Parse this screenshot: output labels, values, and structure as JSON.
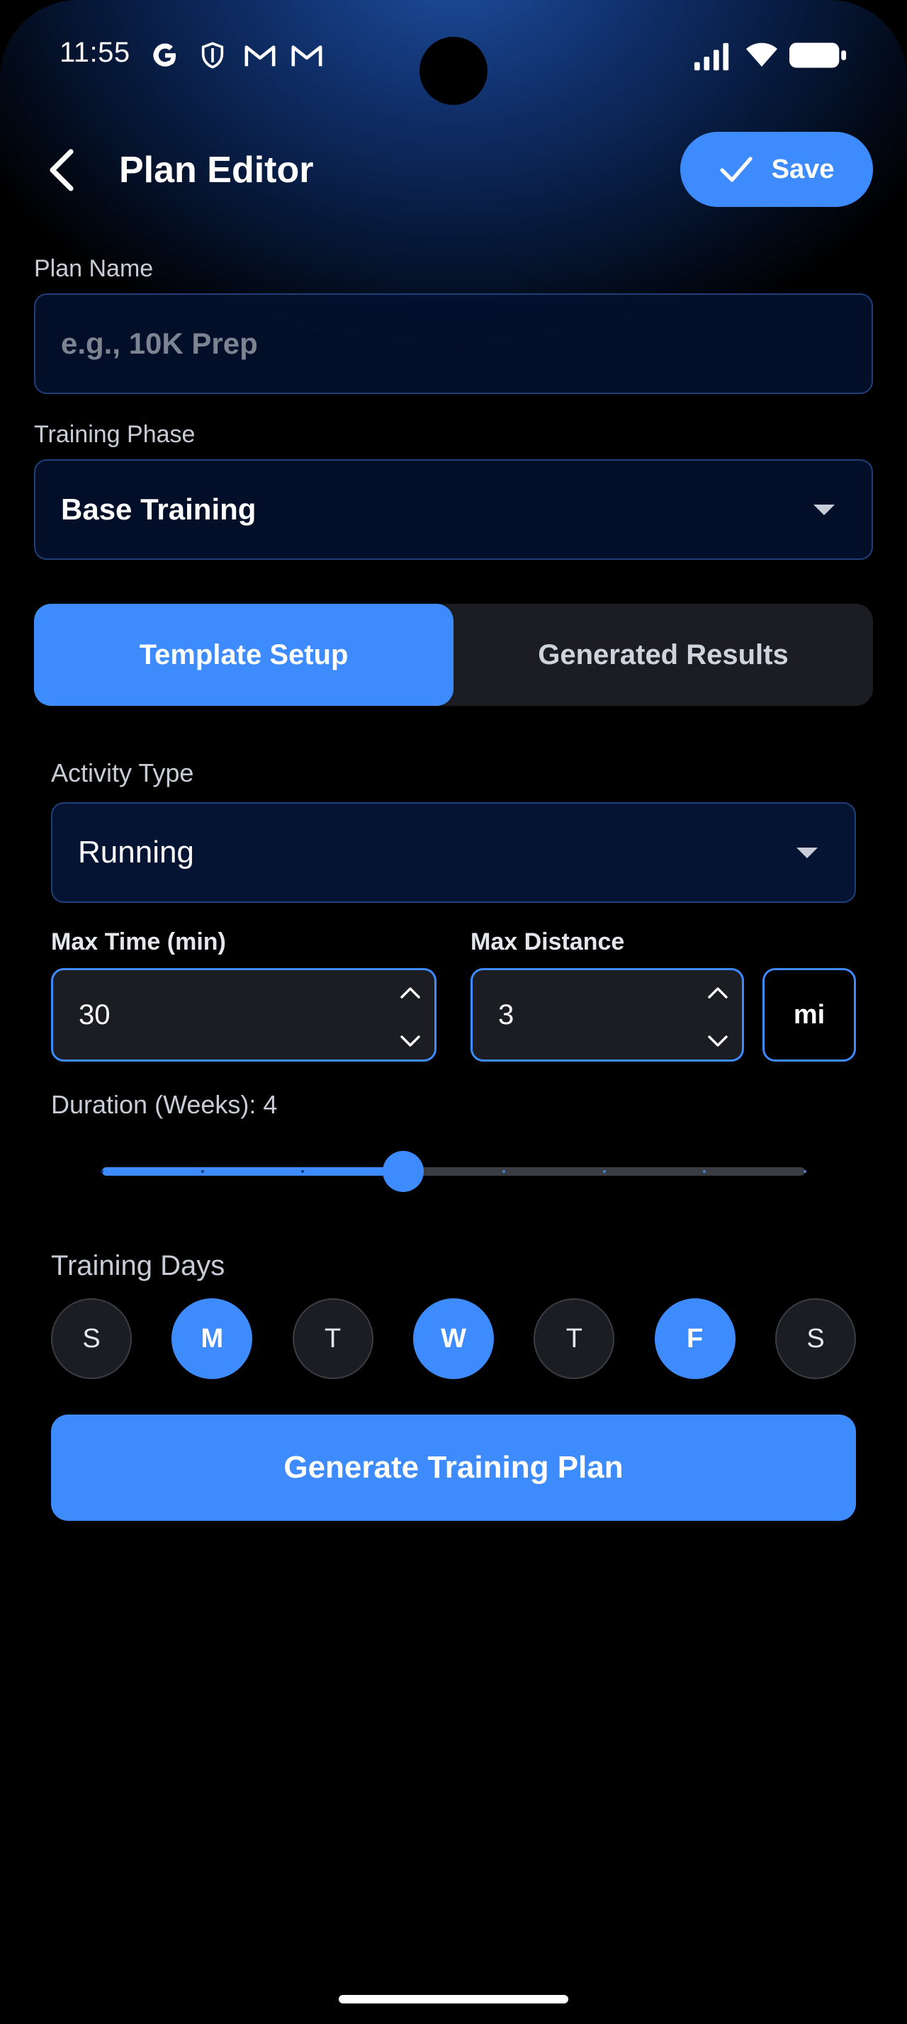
{
  "status_bar": {
    "time": "11:55",
    "icons": [
      "google-g-icon",
      "shield-icon",
      "gmail-icon",
      "gmail-icon",
      "signal-icon",
      "wifi-icon",
      "battery-icon"
    ]
  },
  "header": {
    "title": "Plan Editor",
    "save_label": "Save"
  },
  "plan_name": {
    "label": "Plan Name",
    "placeholder": "e.g., 10K Prep",
    "value": ""
  },
  "training_phase": {
    "label": "Training Phase",
    "value": "Base Training"
  },
  "tabs": [
    {
      "label": "Template Setup",
      "active": true
    },
    {
      "label": "Generated Results",
      "active": false
    }
  ],
  "activity": {
    "label": "Activity Type",
    "value": "Running"
  },
  "max_time": {
    "label": "Max Time (min)",
    "value": "30"
  },
  "max_distance": {
    "label": "Max Distance",
    "value": "3",
    "unit": "mi"
  },
  "duration": {
    "label": "Duration (Weeks): 4",
    "weeks": 4,
    "min": 1,
    "max": 8
  },
  "training_days": {
    "label": "Training Days",
    "days": [
      {
        "letter": "S",
        "selected": false
      },
      {
        "letter": "M",
        "selected": true
      },
      {
        "letter": "T",
        "selected": false
      },
      {
        "letter": "W",
        "selected": true
      },
      {
        "letter": "T",
        "selected": false
      },
      {
        "letter": "F",
        "selected": true
      },
      {
        "letter": "S",
        "selected": false
      }
    ]
  },
  "generate_label": "Generate Training Plan",
  "colors": {
    "accent": "#3d8bfd",
    "surface": "#1b1d22",
    "field_bg": "#061433",
    "field_border": "#1f3f7a"
  }
}
